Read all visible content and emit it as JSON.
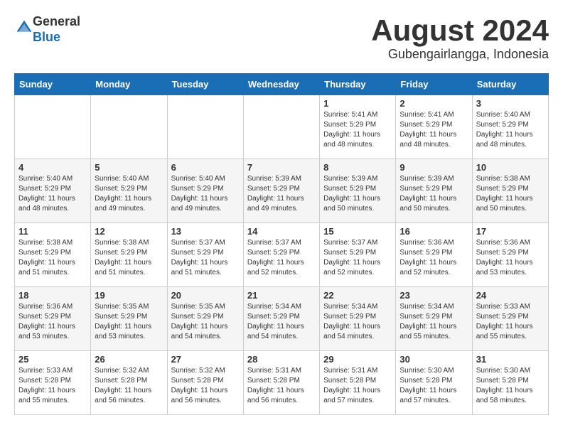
{
  "logo": {
    "general": "General",
    "blue": "Blue"
  },
  "header": {
    "month_year": "August 2024",
    "location": "Gubengairlangga, Indonesia"
  },
  "weekdays": [
    "Sunday",
    "Monday",
    "Tuesday",
    "Wednesday",
    "Thursday",
    "Friday",
    "Saturday"
  ],
  "weeks": [
    [
      {
        "day": "",
        "info": ""
      },
      {
        "day": "",
        "info": ""
      },
      {
        "day": "",
        "info": ""
      },
      {
        "day": "",
        "info": ""
      },
      {
        "day": "1",
        "info": "Sunrise: 5:41 AM\nSunset: 5:29 PM\nDaylight: 11 hours\nand 48 minutes."
      },
      {
        "day": "2",
        "info": "Sunrise: 5:41 AM\nSunset: 5:29 PM\nDaylight: 11 hours\nand 48 minutes."
      },
      {
        "day": "3",
        "info": "Sunrise: 5:40 AM\nSunset: 5:29 PM\nDaylight: 11 hours\nand 48 minutes."
      }
    ],
    [
      {
        "day": "4",
        "info": "Sunrise: 5:40 AM\nSunset: 5:29 PM\nDaylight: 11 hours\nand 48 minutes."
      },
      {
        "day": "5",
        "info": "Sunrise: 5:40 AM\nSunset: 5:29 PM\nDaylight: 11 hours\nand 49 minutes."
      },
      {
        "day": "6",
        "info": "Sunrise: 5:40 AM\nSunset: 5:29 PM\nDaylight: 11 hours\nand 49 minutes."
      },
      {
        "day": "7",
        "info": "Sunrise: 5:39 AM\nSunset: 5:29 PM\nDaylight: 11 hours\nand 49 minutes."
      },
      {
        "day": "8",
        "info": "Sunrise: 5:39 AM\nSunset: 5:29 PM\nDaylight: 11 hours\nand 50 minutes."
      },
      {
        "day": "9",
        "info": "Sunrise: 5:39 AM\nSunset: 5:29 PM\nDaylight: 11 hours\nand 50 minutes."
      },
      {
        "day": "10",
        "info": "Sunrise: 5:38 AM\nSunset: 5:29 PM\nDaylight: 11 hours\nand 50 minutes."
      }
    ],
    [
      {
        "day": "11",
        "info": "Sunrise: 5:38 AM\nSunset: 5:29 PM\nDaylight: 11 hours\nand 51 minutes."
      },
      {
        "day": "12",
        "info": "Sunrise: 5:38 AM\nSunset: 5:29 PM\nDaylight: 11 hours\nand 51 minutes."
      },
      {
        "day": "13",
        "info": "Sunrise: 5:37 AM\nSunset: 5:29 PM\nDaylight: 11 hours\nand 51 minutes."
      },
      {
        "day": "14",
        "info": "Sunrise: 5:37 AM\nSunset: 5:29 PM\nDaylight: 11 hours\nand 52 minutes."
      },
      {
        "day": "15",
        "info": "Sunrise: 5:37 AM\nSunset: 5:29 PM\nDaylight: 11 hours\nand 52 minutes."
      },
      {
        "day": "16",
        "info": "Sunrise: 5:36 AM\nSunset: 5:29 PM\nDaylight: 11 hours\nand 52 minutes."
      },
      {
        "day": "17",
        "info": "Sunrise: 5:36 AM\nSunset: 5:29 PM\nDaylight: 11 hours\nand 53 minutes."
      }
    ],
    [
      {
        "day": "18",
        "info": "Sunrise: 5:36 AM\nSunset: 5:29 PM\nDaylight: 11 hours\nand 53 minutes."
      },
      {
        "day": "19",
        "info": "Sunrise: 5:35 AM\nSunset: 5:29 PM\nDaylight: 11 hours\nand 53 minutes."
      },
      {
        "day": "20",
        "info": "Sunrise: 5:35 AM\nSunset: 5:29 PM\nDaylight: 11 hours\nand 54 minutes."
      },
      {
        "day": "21",
        "info": "Sunrise: 5:34 AM\nSunset: 5:29 PM\nDaylight: 11 hours\nand 54 minutes."
      },
      {
        "day": "22",
        "info": "Sunrise: 5:34 AM\nSunset: 5:29 PM\nDaylight: 11 hours\nand 54 minutes."
      },
      {
        "day": "23",
        "info": "Sunrise: 5:34 AM\nSunset: 5:29 PM\nDaylight: 11 hours\nand 55 minutes."
      },
      {
        "day": "24",
        "info": "Sunrise: 5:33 AM\nSunset: 5:29 PM\nDaylight: 11 hours\nand 55 minutes."
      }
    ],
    [
      {
        "day": "25",
        "info": "Sunrise: 5:33 AM\nSunset: 5:28 PM\nDaylight: 11 hours\nand 55 minutes."
      },
      {
        "day": "26",
        "info": "Sunrise: 5:32 AM\nSunset: 5:28 PM\nDaylight: 11 hours\nand 56 minutes."
      },
      {
        "day": "27",
        "info": "Sunrise: 5:32 AM\nSunset: 5:28 PM\nDaylight: 11 hours\nand 56 minutes."
      },
      {
        "day": "28",
        "info": "Sunrise: 5:31 AM\nSunset: 5:28 PM\nDaylight: 11 hours\nand 56 minutes."
      },
      {
        "day": "29",
        "info": "Sunrise: 5:31 AM\nSunset: 5:28 PM\nDaylight: 11 hours\nand 57 minutes."
      },
      {
        "day": "30",
        "info": "Sunrise: 5:30 AM\nSunset: 5:28 PM\nDaylight: 11 hours\nand 57 minutes."
      },
      {
        "day": "31",
        "info": "Sunrise: 5:30 AM\nSunset: 5:28 PM\nDaylight: 11 hours\nand 58 minutes."
      }
    ]
  ]
}
